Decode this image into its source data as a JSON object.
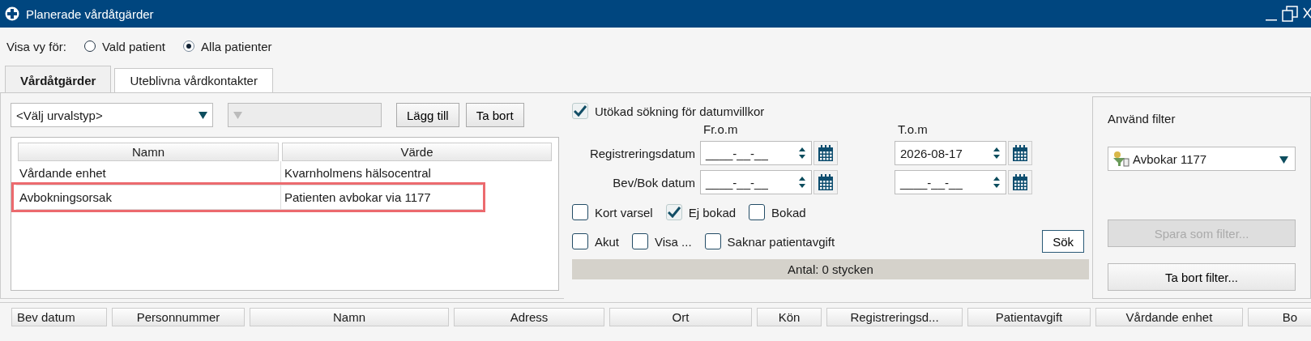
{
  "window": {
    "title": "Planerade vårdåtgärder"
  },
  "view_for": {
    "label": "Visa vy för:",
    "options": [
      {
        "label": "Vald patient",
        "selected": false
      },
      {
        "label": "Alla patienter",
        "selected": true
      }
    ]
  },
  "tabs": [
    {
      "label": "Vårdåtgärder",
      "selected": true
    },
    {
      "label": "Uteblivna vårdkontakter",
      "selected": false
    }
  ],
  "criteria": {
    "type_select": {
      "value": "<Välj urvalstyp>"
    },
    "value_select": {
      "disabled": true
    },
    "buttons": [
      "Lägg till",
      "Ta bort"
    ],
    "table": {
      "columns": [
        "Namn",
        "Värde"
      ],
      "rows": [
        {
          "cells": [
            "Vårdande enhet",
            "Kvarnholmens hälsocentral"
          ],
          "highlighted": false
        },
        {
          "cells": [
            "Avbokningsorsak",
            "Patienten avbokar via 1177"
          ],
          "highlighted": true
        }
      ]
    }
  },
  "search": {
    "extended": {
      "label": "Utökad sökning för datumvillkor",
      "checked": true
    },
    "from_label": "Fr.o.m",
    "to_label": "T.o.m",
    "date_rows": [
      {
        "label": "Registreringsdatum",
        "from": "____-__-__",
        "to": "2026-08-17"
      },
      {
        "label": "Bev/Bok datum",
        "from": "____-__-__",
        "to": "____-__-__"
      }
    ],
    "checkbox_rows": [
      [
        {
          "label": "Kort varsel",
          "checked": false
        },
        {
          "label": "Ej bokad",
          "checked": true
        },
        {
          "label": "Bokad",
          "checked": false
        }
      ],
      [
        {
          "label": "Akut",
          "checked": false
        },
        {
          "label": "Visa ...",
          "checked": false
        },
        {
          "label": "Saknar patientavgift",
          "checked": false
        }
      ]
    ],
    "search_button": "Sök",
    "count": "Antal: 0 stycken"
  },
  "filter": {
    "label": "Använd filter",
    "selected_filter": "Avbokar 1177",
    "buttons": [
      {
        "label": "Spara som filter...",
        "disabled": true
      },
      {
        "label": "Ta bort filter...",
        "disabled": false
      }
    ]
  },
  "results": {
    "columns": [
      "Bev datum",
      "Personnummer",
      "Namn",
      "Adress",
      "Ort",
      "Kön",
      "Registreringsd...",
      "Patientavgift",
      "Vårdande enhet",
      "Bo"
    ]
  }
}
